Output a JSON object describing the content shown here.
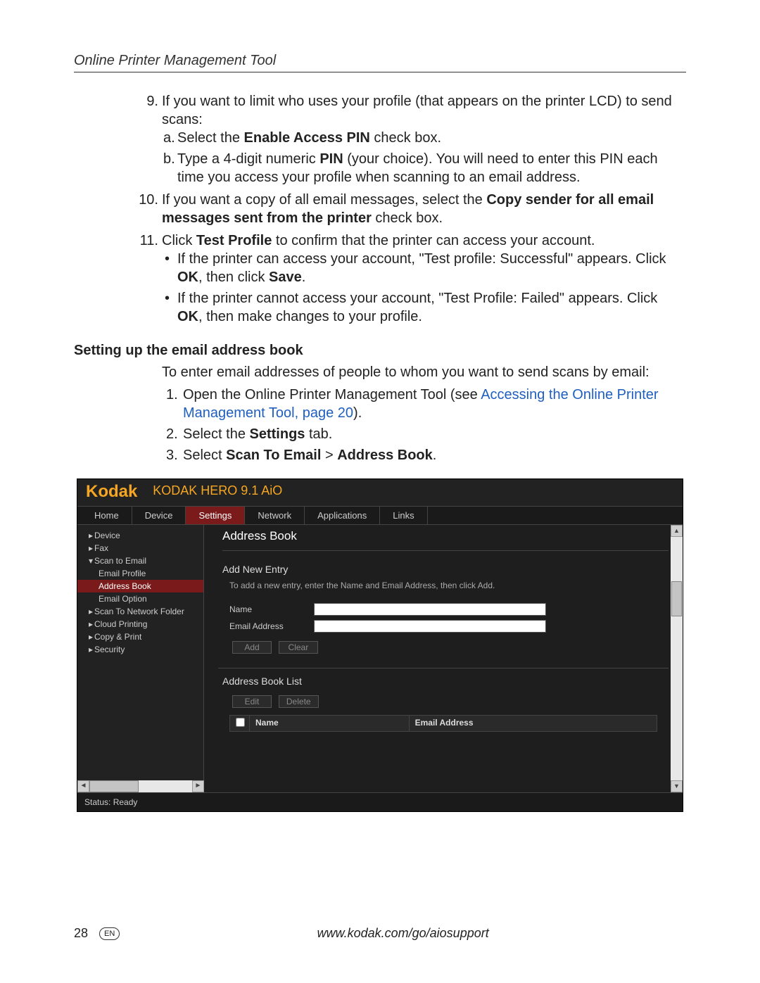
{
  "header": "Online Printer Management Tool",
  "items": {
    "i9": "If you want to limit who uses your profile (that appears on the printer LCD) to send scans:",
    "i9a_a": "Select the ",
    "i9a_b": "Enable Access PIN",
    "i9a_c": " check box.",
    "i9b_a": "Type a 4-digit numeric ",
    "i9b_b": "PIN",
    "i9b_c": " (your choice). You will need to enter this PIN each time you access your profile when scanning to an email address.",
    "i10_a": "If you want a copy of all email messages, select the ",
    "i10_b": "Copy sender for all email messages sent from the printer",
    "i10_c": " check box.",
    "i11_a": "Click ",
    "i11_b": "Test Profile",
    "i11_c": " to confirm that the printer can access your account.",
    "i11s1_a": "If the printer can access your account, \"Test profile: Successful\" appears. Click ",
    "i11s1_b": "OK",
    "i11s1_c": ", then click ",
    "i11s1_d": "Save",
    "i11s1_e": ".",
    "i11s2_a": "If the printer cannot access your account, \"Test Profile: Failed\" appears. Click ",
    "i11s2_b": "OK",
    "i11s2_c": ", then make changes to your profile."
  },
  "section": "Setting up the email address book",
  "intro": "To enter email addresses of people to whom you want to send scans by email:",
  "steps": {
    "s1_a": "Open the Online Printer Management Tool (see ",
    "s1_link": "Accessing the Online Printer Management Tool, page 20",
    "s1_b": ").",
    "s2_a": "Select the ",
    "s2_b": "Settings",
    "s2_c": " tab.",
    "s3_a": "Select ",
    "s3_b": "Scan To Email",
    "s3_c": " > ",
    "s3_d": "Address Book",
    "s3_e": "."
  },
  "shot": {
    "brand": "Kodak",
    "product": "KODAK HERO 9.1 AiO",
    "tabs": [
      "Home",
      "Device",
      "Settings",
      "Network",
      "Applications",
      "Links"
    ],
    "active_tab": "Settings",
    "sidebar": {
      "Device": "Device",
      "Fax": "Fax",
      "ScanToEmail": "Scan to Email",
      "EmailProfile": "Email Profile",
      "AddressBook": "Address Book",
      "EmailOption": "Email Option",
      "ScanToNetworkFolder": "Scan To Network Folder",
      "CloudPrinting": "Cloud Printing",
      "CopyPrint": "Copy & Print",
      "Security": "Security"
    },
    "page_title": "Address Book",
    "form_title": "Add New Entry",
    "help": "To add a new entry, enter the Name and Email Address, then click Add.",
    "name_label": "Name",
    "email_label": "Email Address",
    "add": "Add",
    "clear": "Clear",
    "list_title": "Address Book List",
    "edit": "Edit",
    "delete": "Delete",
    "col_name": "Name",
    "col_email": "Email Address",
    "status": "Status: Ready"
  },
  "footer": {
    "page": "28",
    "lang": "EN",
    "url": "www.kodak.com/go/aiosupport"
  }
}
